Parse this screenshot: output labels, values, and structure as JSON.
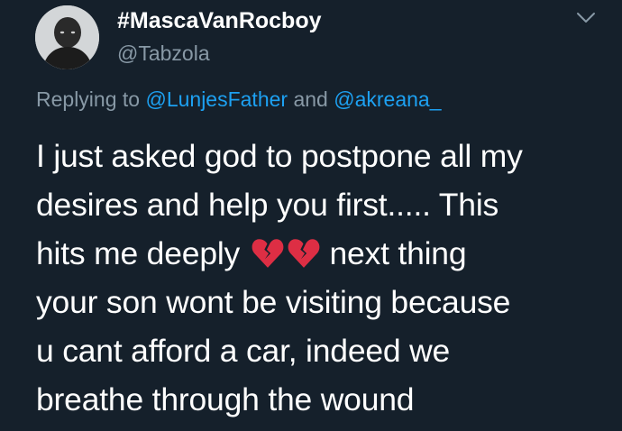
{
  "author": {
    "display_name": "#MascaVanRocboy",
    "handle": "@Tabzola"
  },
  "reply": {
    "prefix": "Replying to",
    "mention_1": "@LunjesFather",
    "conjunction": "and",
    "mention_2": "@akreana_"
  },
  "tweet": {
    "line_1": "I just asked god to postpone all my",
    "line_2": "desires and help you first..... This",
    "line_3_before": "hits me deeply",
    "line_3_after": "next thing",
    "line_4": "your son wont be visiting because",
    "line_5": "u cant afford a car, indeed we",
    "line_6": "breathe through the wound",
    "emoji": [
      "broken-heart-emoji",
      "broken-heart-emoji"
    ]
  },
  "colors": {
    "background": "#15202b",
    "primary_text": "#ffffff",
    "secondary_text": "#8899a6",
    "mention": "#1da1f2",
    "emoji_red": "#dd2e44"
  },
  "icons": {
    "menu": "chevron-down-icon"
  }
}
